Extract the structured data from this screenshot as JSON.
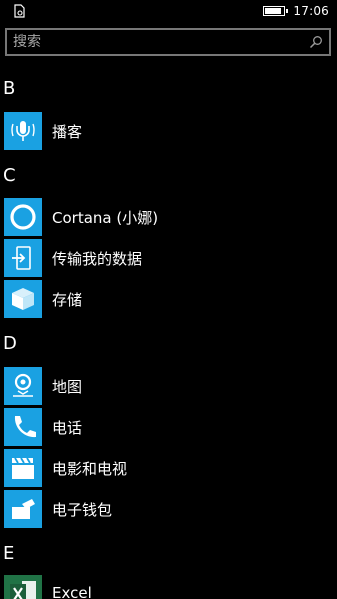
{
  "status": {
    "time": "17:06",
    "battery_level": 0.9
  },
  "search": {
    "placeholder": "搜索"
  },
  "sections": [
    {
      "letter": "B",
      "apps": [
        {
          "label": "播客",
          "icon": "podcast-icon"
        }
      ]
    },
    {
      "letter": "C",
      "apps": [
        {
          "label": "Cortana (小娜)",
          "icon": "cortana-icon"
        },
        {
          "label": "传输我的数据",
          "icon": "transfer-data-icon"
        },
        {
          "label": "存储",
          "icon": "storage-icon"
        }
      ]
    },
    {
      "letter": "D",
      "apps": [
        {
          "label": "地图",
          "icon": "maps-icon"
        },
        {
          "label": "电话",
          "icon": "phone-icon"
        },
        {
          "label": "电影和电视",
          "icon": "movies-tv-icon"
        },
        {
          "label": "电子钱包",
          "icon": "wallet-icon"
        }
      ]
    },
    {
      "letter": "E",
      "apps": [
        {
          "label": "Excel",
          "icon": "excel-icon"
        }
      ]
    }
  ],
  "colors": {
    "tile": "#1aa1e2",
    "excel_tile": "#207346",
    "background": "#000000"
  }
}
